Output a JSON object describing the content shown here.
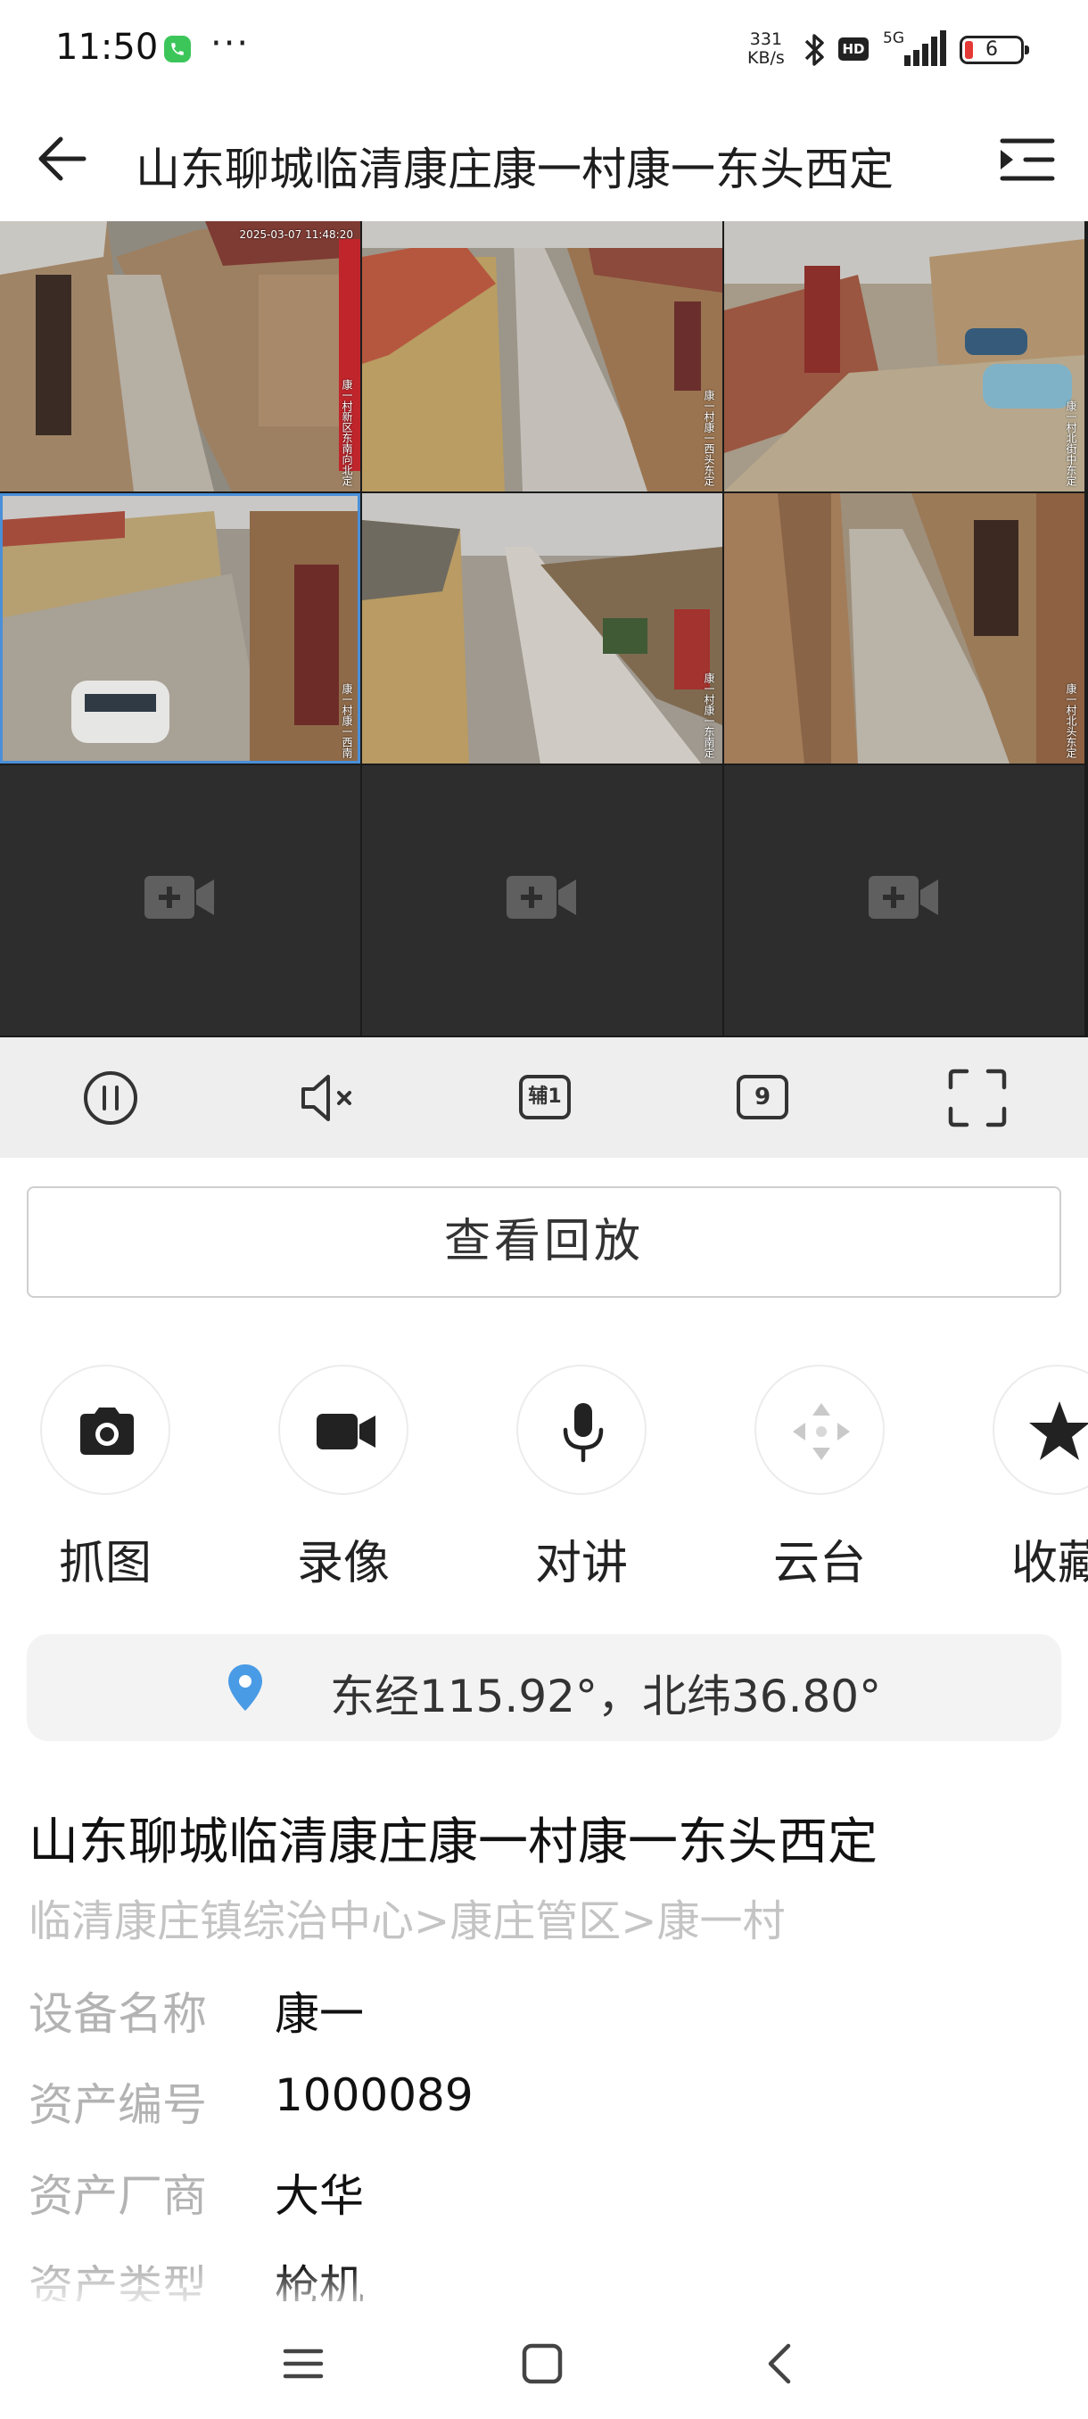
{
  "status_bar": {
    "time": "11:50",
    "dots": "···",
    "net_speed_value": "331",
    "net_speed_unit": "KB/s",
    "hd": "HD",
    "network": "5G",
    "battery": "6",
    "icons": [
      "phone-call-icon",
      "bluetooth-icon",
      "signal-icon",
      "battery-icon"
    ]
  },
  "header": {
    "title": "山东聊城临清康庄康一村康一东头西定",
    "back_icon": "arrow-left-icon",
    "menu_icon": "channel-list-icon"
  },
  "video_grid": {
    "tiles": [
      {
        "state": "live",
        "osd_time": "2025-03-07 11:48:20",
        "osd": "康一村新区东南向北定"
      },
      {
        "state": "live",
        "osd": "康一村康一西头东定"
      },
      {
        "state": "live",
        "osd": "康一村北街中东定"
      },
      {
        "state": "live",
        "selected": true,
        "osd": "康一村康一西南"
      },
      {
        "state": "live",
        "osd": "康一村康一东南定"
      },
      {
        "state": "live",
        "osd": "康一村北头东定"
      },
      {
        "state": "empty"
      },
      {
        "state": "empty"
      },
      {
        "state": "empty"
      }
    ],
    "colors": {
      "empty_tile": "#2d2d2d",
      "selected_outline": "#4a8fd8"
    }
  },
  "control_bar": {
    "pause_icon": "pause-icon",
    "mute_icon": "volume-mute-icon",
    "aux_label": "辅1",
    "split_label": "9",
    "fullscreen_icon": "fullscreen-icon"
  },
  "playback": {
    "label": "查看回放"
  },
  "actions": [
    {
      "label": "抓图",
      "icon": "camera-icon"
    },
    {
      "label": "录像",
      "icon": "video-camera-icon"
    },
    {
      "label": "对讲",
      "icon": "microphone-icon"
    },
    {
      "label": "云台",
      "icon": "ptz-arrows-icon"
    },
    {
      "label": "收藏",
      "icon": "star-icon"
    }
  ],
  "location": {
    "icon": "location-pin-icon",
    "text": "东经115.92°，北纬36.80°",
    "pin_color": "#4a9be6"
  },
  "device": {
    "title": "山东聊城临清康庄康一村康一东头西定",
    "breadcrumb": "临清康庄镇综治中心>康庄管区>康一村",
    "fields": [
      {
        "key": "设备名称",
        "value": "康一"
      },
      {
        "key": "资产编号",
        "value": "1000089"
      },
      {
        "key": "资产厂商",
        "value": "大华"
      },
      {
        "key": "资产类型",
        "value": "枪机"
      }
    ]
  },
  "nav_bar": {
    "icons": [
      "menu-icon",
      "home-icon",
      "back-icon"
    ]
  }
}
